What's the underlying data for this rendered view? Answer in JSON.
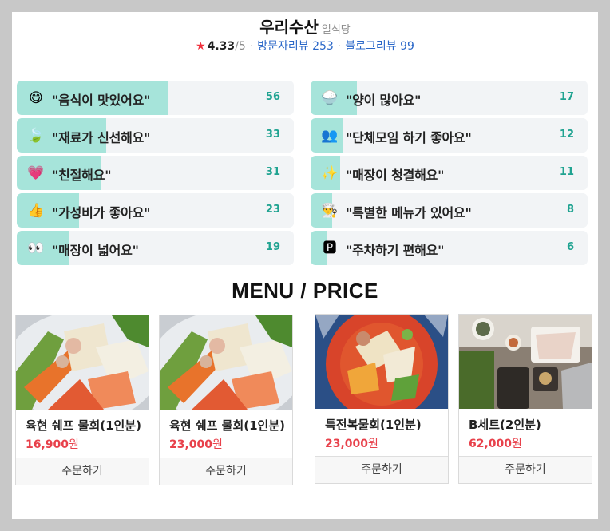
{
  "place": {
    "name": "우리수산",
    "category": "일식당",
    "rating": "4.33",
    "rating_max": "/5",
    "visitor_reviews": "방문자리뷰 253",
    "blog_reviews": "블로그리뷰 99"
  },
  "colors": {
    "accent": "#20a391",
    "bar": "#a6e4da",
    "price": "#e8414b",
    "link": "#2a67c8"
  },
  "reviews_left": [
    {
      "emoji": "😋",
      "icon": "yummy-face-icon",
      "text": "\"음식이 맛있어요\"",
      "count": "56",
      "fill": 0.56
    },
    {
      "emoji": "🍃",
      "icon": "leaf-icon",
      "text": "\"재료가 신선해요\"",
      "count": "33",
      "fill": 0.33
    },
    {
      "emoji": "💗",
      "icon": "heart-icon",
      "text": "\"친절해요\"",
      "count": "31",
      "fill": 0.31
    },
    {
      "emoji": "👍",
      "icon": "thumbs-up-icon",
      "text": "\"가성비가 좋아요\"",
      "count": "23",
      "fill": 0.23
    },
    {
      "emoji": "👀",
      "icon": "eyes-icon",
      "text": "\"매장이 넓어요\"",
      "count": "19",
      "fill": 0.19
    }
  ],
  "reviews_right": [
    {
      "emoji": "🍚",
      "icon": "rice-bowl-icon",
      "text": "\"양이 많아요\"",
      "count": "17",
      "fill": 0.17
    },
    {
      "emoji": "👥",
      "icon": "group-icon",
      "text": "\"단체모임 하기 좋아요\"",
      "count": "12",
      "fill": 0.12
    },
    {
      "emoji": "✨",
      "icon": "sparkles-icon",
      "text": "\"매장이 청결해요\"",
      "count": "11",
      "fill": 0.11
    },
    {
      "emoji": "👨‍🍳",
      "icon": "chef-icon",
      "text": "\"특별한 메뉴가 있어요\"",
      "count": "8",
      "fill": 0.08
    },
    {
      "emoji": "🅿",
      "icon": "parking-icon",
      "text": "\"주차하기 편해요\"",
      "count": "6",
      "fill": 0.06
    }
  ],
  "menu_title": "MENU / PRICE",
  "menu": [
    {
      "name": "육현 쉐프 물회(1인분)",
      "price": "16,900",
      "unit": "원",
      "order": "주문하기",
      "image": "mulhoe-photo"
    },
    {
      "name": "육현 쉐프 물회(1인분)",
      "price": "23,000",
      "unit": "원",
      "order": "주문하기",
      "image": "mulhoe-photo"
    },
    {
      "name": "특전복물회(1인분)",
      "price": "23,000",
      "unit": "원",
      "order": "주문하기",
      "image": "abalone-mulhoe-photo"
    },
    {
      "name": "B세트(2인분)",
      "price": "62,000",
      "unit": "원",
      "order": "주문하기",
      "image": "set-table-photo"
    }
  ]
}
